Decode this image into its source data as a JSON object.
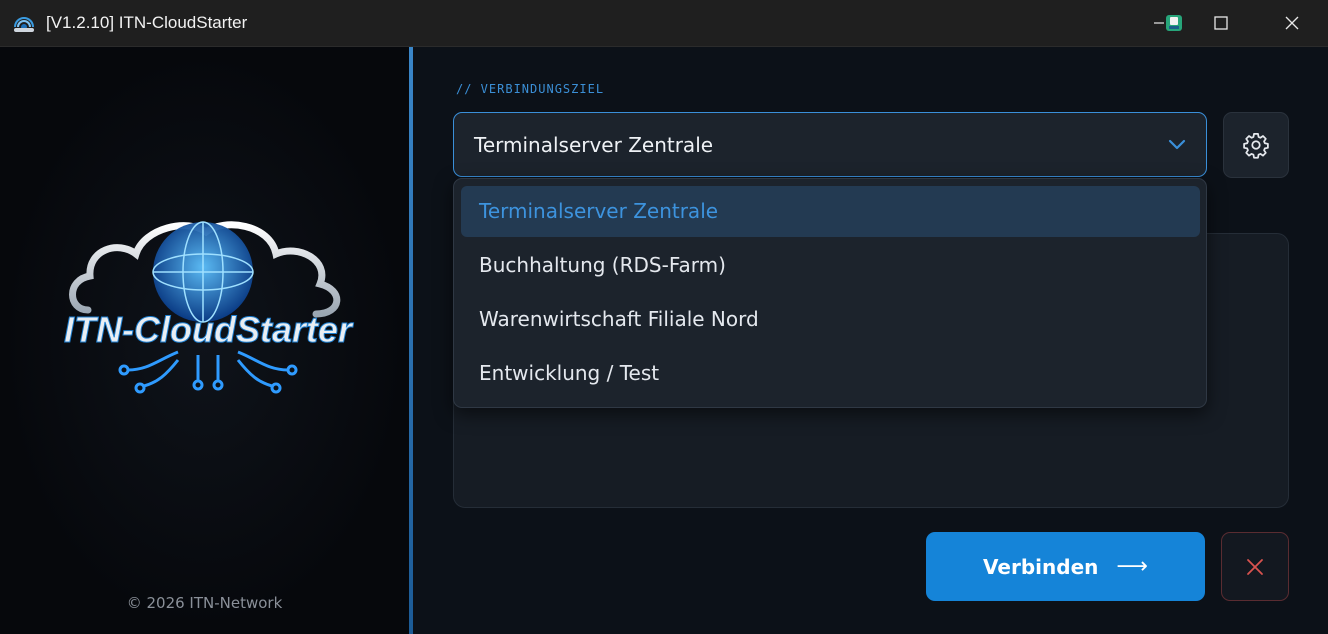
{
  "window": {
    "title": "[V1.2.10] ITN-CloudStarter",
    "icons": [
      "app-icon",
      "minimize-icon",
      "tray-icon",
      "maximize-icon",
      "close-icon"
    ]
  },
  "branding": {
    "logo_text": "ITN-CloudStarter",
    "copyright": "© 2026 ITN-Network"
  },
  "connection": {
    "section_label": "// VERBINDUNGSZIEL",
    "selected": "Terminalserver Zentrale",
    "options": [
      "Terminalserver Zentrale",
      "Buchhaltung (RDS-Farm)",
      "Warenwirtschaft Filiale Nord",
      "Entwicklung / Test"
    ],
    "settings_icon": "gear-icon"
  },
  "actions": {
    "connect_label": "Verbinden",
    "connect_arrow": "⟶",
    "cancel_icon": "close-icon"
  },
  "colors": {
    "accent": "#1584d8",
    "selected_text": "#3d93de",
    "cancel": "#d9534f"
  }
}
